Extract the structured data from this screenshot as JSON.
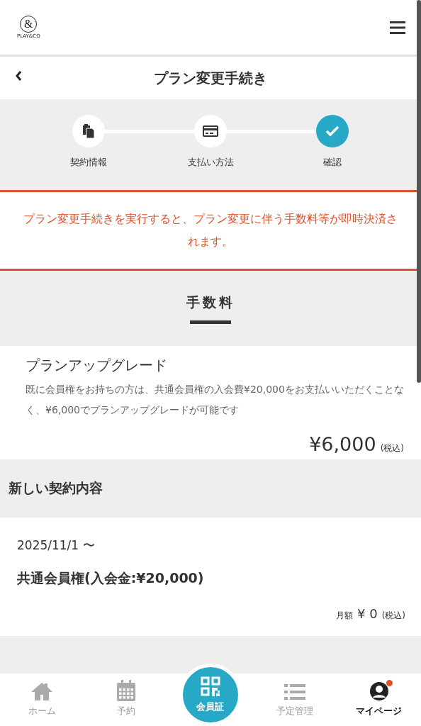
{
  "header": {
    "logo_mark": "&",
    "logo_text": "PLAY&CO"
  },
  "title_bar": {
    "title": "プラン変更手続き"
  },
  "steps": [
    {
      "label": "契約情報",
      "kind": "document",
      "selected": false
    },
    {
      "label": "支払い方法",
      "kind": "card",
      "selected": false
    },
    {
      "label": "確認",
      "kind": "check",
      "selected": true
    }
  ],
  "alert": "プラン変更手続きを実行すると、プラン変更に伴う手数料等が即時決済されます。",
  "fee_section": {
    "heading": "手数料",
    "item_title": "プランアップグレード",
    "description": "既に会員権をお持ちの方は、共通会員権の入会費¥20,000をお支払いいただくことなく、¥6,000でプランアップグレードが可能です",
    "price": "¥6,000",
    "tax": "(税込)"
  },
  "new_contract": {
    "heading": "新しい契約内容",
    "date": "2025/11/1 〜",
    "plan": "共通会員権(入会金:¥20,000)",
    "monthly_label": "月額",
    "monthly_price": "¥ 0",
    "tax": "(税込)"
  },
  "tab_bar": [
    {
      "label": "ホーム",
      "kind": "home",
      "selected": false
    },
    {
      "label": "予約",
      "kind": "calendar",
      "selected": false
    },
    {
      "label": "会員証",
      "kind": "qr"
    },
    {
      "label": "予定管理",
      "kind": "list",
      "selected": false
    },
    {
      "label": "マイページ",
      "kind": "user",
      "selected": true,
      "badge": true
    }
  ]
}
